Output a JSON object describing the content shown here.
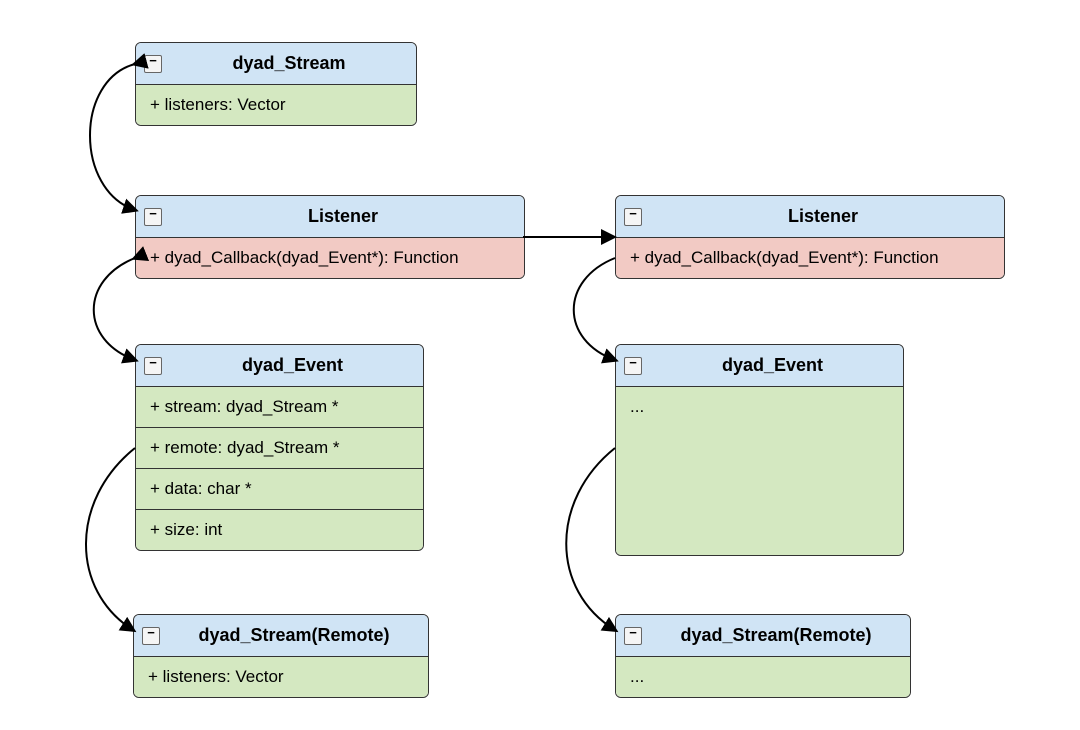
{
  "toggle_glyph": "−",
  "boxes": {
    "stream_main": {
      "title": "dyad_Stream",
      "rows": [
        "+ listeners: Vector"
      ]
    },
    "listener_left": {
      "title": "Listener",
      "rows": [
        "+ dyad_Callback(dyad_Event*): Function"
      ]
    },
    "listener_right": {
      "title": "Listener",
      "rows": [
        "+ dyad_Callback(dyad_Event*): Function"
      ]
    },
    "event_left": {
      "title": "dyad_Event",
      "rows": [
        "+ stream: dyad_Stream *",
        "+ remote: dyad_Stream *",
        "+ data: char *",
        "+ size: int"
      ]
    },
    "event_right": {
      "title": "dyad_Event",
      "rows": [
        "..."
      ]
    },
    "stream_remote_left": {
      "title": "dyad_Stream(Remote)",
      "rows": [
        "+ listeners: Vector"
      ]
    },
    "stream_remote_right": {
      "title": "dyad_Stream(Remote)",
      "rows": [
        "..."
      ]
    }
  }
}
